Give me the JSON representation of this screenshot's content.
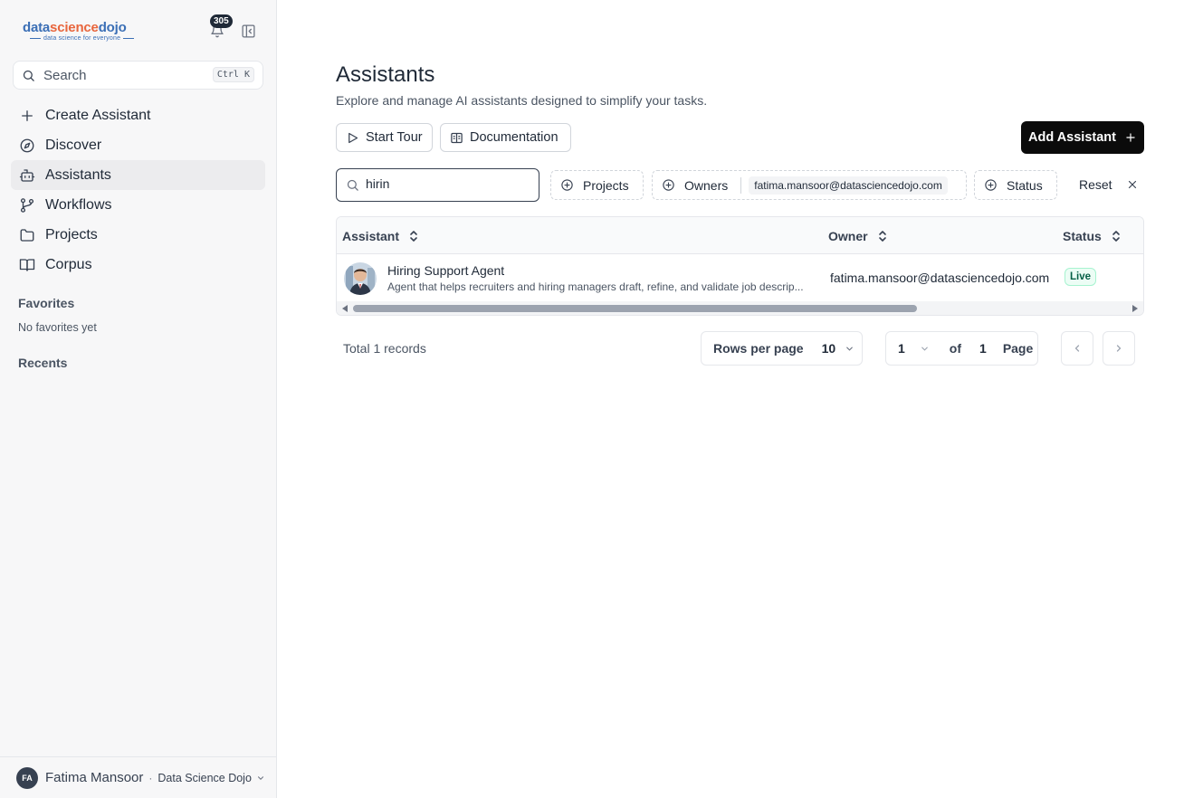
{
  "sidebar": {
    "logo": {
      "part1": "data",
      "part2": "science",
      "part3": "dojo",
      "tagline": "data science for everyone"
    },
    "notifications_count": "305",
    "search": {
      "placeholder": "Search",
      "shortcut": "Ctrl K"
    },
    "nav": [
      {
        "label": "Create Assistant",
        "icon": "plus-icon"
      },
      {
        "label": "Discover",
        "icon": "compass-icon"
      },
      {
        "label": "Assistants",
        "icon": "bot-icon",
        "active": true
      },
      {
        "label": "Workflows",
        "icon": "git-branch-icon"
      },
      {
        "label": "Projects",
        "icon": "folder-icon"
      },
      {
        "label": "Corpus",
        "icon": "book-icon"
      }
    ],
    "favorites": {
      "title": "Favorites",
      "empty": "No favorites yet"
    },
    "recents": {
      "title": "Recents"
    },
    "user": {
      "initials": "FA",
      "name": "Fatima Mansoor",
      "separator": "·",
      "org": "Data Science Dojo"
    }
  },
  "main": {
    "title": "Assistants",
    "subtitle": "Explore and manage AI assistants designed to simplify your tasks.",
    "start_tour": "Start Tour",
    "documentation": "Documentation",
    "add_assistant": "Add Assistant",
    "filter": {
      "search_value": "hirin",
      "projects": "Projects",
      "owners": "Owners",
      "owner_tag": "fatima.mansoor@datasciencedojo.com",
      "status": "Status",
      "reset": "Reset"
    },
    "table": {
      "columns": [
        "Assistant",
        "Owner",
        "Status"
      ],
      "rows": [
        {
          "name": "Hiring Support Agent",
          "description": "Agent that helps recruiters and hiring managers draft, refine, and validate job descrip...",
          "owner": "fatima.mansoor@datasciencedojo.com",
          "status": "Live"
        }
      ]
    },
    "footer": {
      "total": "Total 1 records",
      "rows_per_page_label": "Rows per page",
      "rows_per_page_value": "10",
      "page_value": "1",
      "of": "of",
      "total_pages": "1",
      "page_label": "Page"
    }
  },
  "colors": {
    "primary_button": "#0b0b0b",
    "live_badge": "#065f46",
    "logo_blue": "#3b6fb6",
    "logo_orange": "#e8663d"
  }
}
